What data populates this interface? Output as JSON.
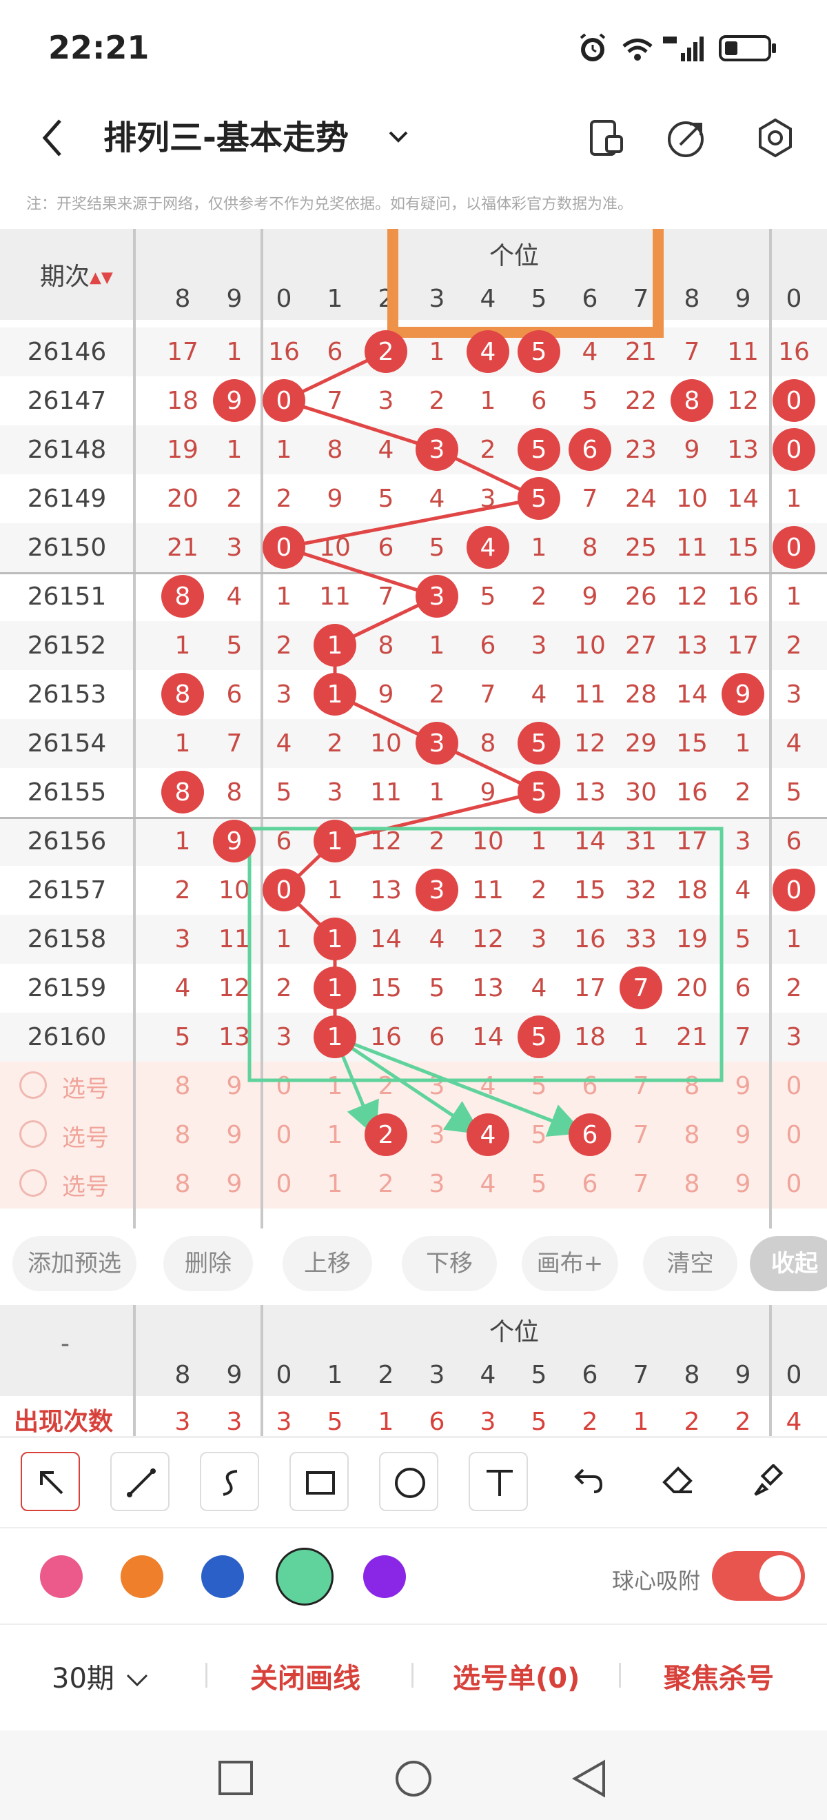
{
  "status": {
    "time": "22:21"
  },
  "header": {
    "title": "排列三-基本走势"
  },
  "notice": "注：开奖结果来源于网络，仅供参考不作为兑奖依据。如有疑问，以福体彩官方数据为准。",
  "table": {
    "period_header": "期次",
    "group_label": "个位",
    "left_cols": [
      "8",
      "9"
    ],
    "digit_cols": [
      "0",
      "1",
      "2",
      "3",
      "4",
      "5",
      "6",
      "7",
      "8",
      "9"
    ],
    "right_cols": [
      "0"
    ],
    "rows": [
      {
        "period": "26146",
        "left": [
          "17",
          "1"
        ],
        "digits": [
          "16",
          "6",
          "2",
          "1",
          "4",
          "5",
          "4",
          "21",
          "7",
          "11"
        ],
        "right": [
          "16"
        ]
      },
      {
        "period": "26147",
        "left": [
          "18",
          "9"
        ],
        "digits": [
          "0",
          "7",
          "3",
          "2",
          "1",
          "6",
          "5",
          "22",
          "8",
          "12"
        ],
        "right": [
          "0"
        ]
      },
      {
        "period": "26148",
        "left": [
          "19",
          "1"
        ],
        "digits": [
          "1",
          "8",
          "4",
          "3",
          "2",
          "5",
          "6",
          "23",
          "9",
          "13"
        ],
        "right": [
          "0"
        ]
      },
      {
        "period": "26149",
        "left": [
          "20",
          "2"
        ],
        "digits": [
          "2",
          "9",
          "5",
          "4",
          "3",
          "5",
          "7",
          "24",
          "10",
          "14"
        ],
        "right": [
          "1"
        ]
      },
      {
        "period": "26150",
        "left": [
          "21",
          "3"
        ],
        "digits": [
          "0",
          "10",
          "6",
          "5",
          "4",
          "1",
          "8",
          "25",
          "11",
          "15"
        ],
        "right": [
          "0"
        ]
      },
      {
        "period": "26151",
        "left": [
          "8",
          "4"
        ],
        "digits": [
          "1",
          "11",
          "7",
          "3",
          "5",
          "2",
          "9",
          "26",
          "12",
          "16"
        ],
        "right": [
          "1"
        ]
      },
      {
        "period": "26152",
        "left": [
          "1",
          "5"
        ],
        "digits": [
          "2",
          "1",
          "8",
          "1",
          "6",
          "3",
          "10",
          "27",
          "13",
          "17"
        ],
        "right": [
          "2"
        ]
      },
      {
        "period": "26153",
        "left": [
          "8",
          "6"
        ],
        "digits": [
          "3",
          "1",
          "9",
          "2",
          "7",
          "4",
          "11",
          "28",
          "14",
          "9"
        ],
        "right": [
          "3"
        ]
      },
      {
        "period": "26154",
        "left": [
          "1",
          "7"
        ],
        "digits": [
          "4",
          "2",
          "10",
          "3",
          "8",
          "5",
          "12",
          "29",
          "15",
          "1"
        ],
        "right": [
          "4"
        ]
      },
      {
        "period": "26155",
        "left": [
          "8",
          "8"
        ],
        "digits": [
          "5",
          "3",
          "11",
          "1",
          "9",
          "5",
          "13",
          "30",
          "16",
          "2"
        ],
        "right": [
          "5"
        ]
      },
      {
        "period": "26156",
        "left": [
          "1",
          "9"
        ],
        "digits": [
          "6",
          "1",
          "12",
          "2",
          "10",
          "1",
          "14",
          "31",
          "17",
          "3"
        ],
        "right": [
          "6"
        ]
      },
      {
        "period": "26157",
        "left": [
          "2",
          "10"
        ],
        "digits": [
          "0",
          "1",
          "13",
          "3",
          "11",
          "2",
          "15",
          "32",
          "18",
          "4"
        ],
        "right": [
          "0"
        ]
      },
      {
        "period": "26158",
        "left": [
          "3",
          "11"
        ],
        "digits": [
          "1",
          "1",
          "14",
          "4",
          "12",
          "3",
          "16",
          "33",
          "19",
          "5"
        ],
        "right": [
          "1"
        ]
      },
      {
        "period": "26159",
        "left": [
          "4",
          "12"
        ],
        "digits": [
          "2",
          "1",
          "15",
          "5",
          "13",
          "4",
          "17",
          "7",
          "20",
          "6"
        ],
        "right": [
          "2"
        ]
      },
      {
        "period": "26160",
        "left": [
          "5",
          "13"
        ],
        "digits": [
          "3",
          "1",
          "16",
          "6",
          "14",
          "5",
          "18",
          "1",
          "21",
          "7"
        ],
        "right": [
          "3"
        ]
      }
    ],
    "select_label": "选号",
    "select_rows_count": 3
  },
  "buttons": {
    "add_preselect": "添加预选",
    "delete": "删除",
    "move_up": "上移",
    "move_down": "下移",
    "canvas_plus": "画布+",
    "clear": "清空",
    "collapse": "收起"
  },
  "stats": {
    "dash": "-",
    "group_label": "个位",
    "label": "出现次数",
    "left_values": [
      "3",
      "3"
    ],
    "values": [
      "3",
      "5",
      "1",
      "6",
      "3",
      "5",
      "2",
      "1",
      "2",
      "2"
    ],
    "right_values": [
      "4"
    ]
  },
  "tools": [
    "arrow-tool",
    "line-tool",
    "curve-tool",
    "rectangle-tool",
    "circle-tool",
    "text-tool",
    "undo-tool",
    "eraser-tool",
    "brush-tool"
  ],
  "colors": {
    "selected": "#5fd39b",
    "palette": [
      "#eb5a8a",
      "#ef7f2a",
      "#2a60c8",
      "#5fd39b",
      "#8a26e6"
    ],
    "accent": "#d8403a",
    "ball": "#e14646"
  },
  "snap": {
    "label": "球心吸附"
  },
  "bottom": {
    "period_select": "30期",
    "close_drawing": "关闭画线",
    "selection_list": "选号单(0)",
    "focus_kill": "聚焦杀号"
  }
}
